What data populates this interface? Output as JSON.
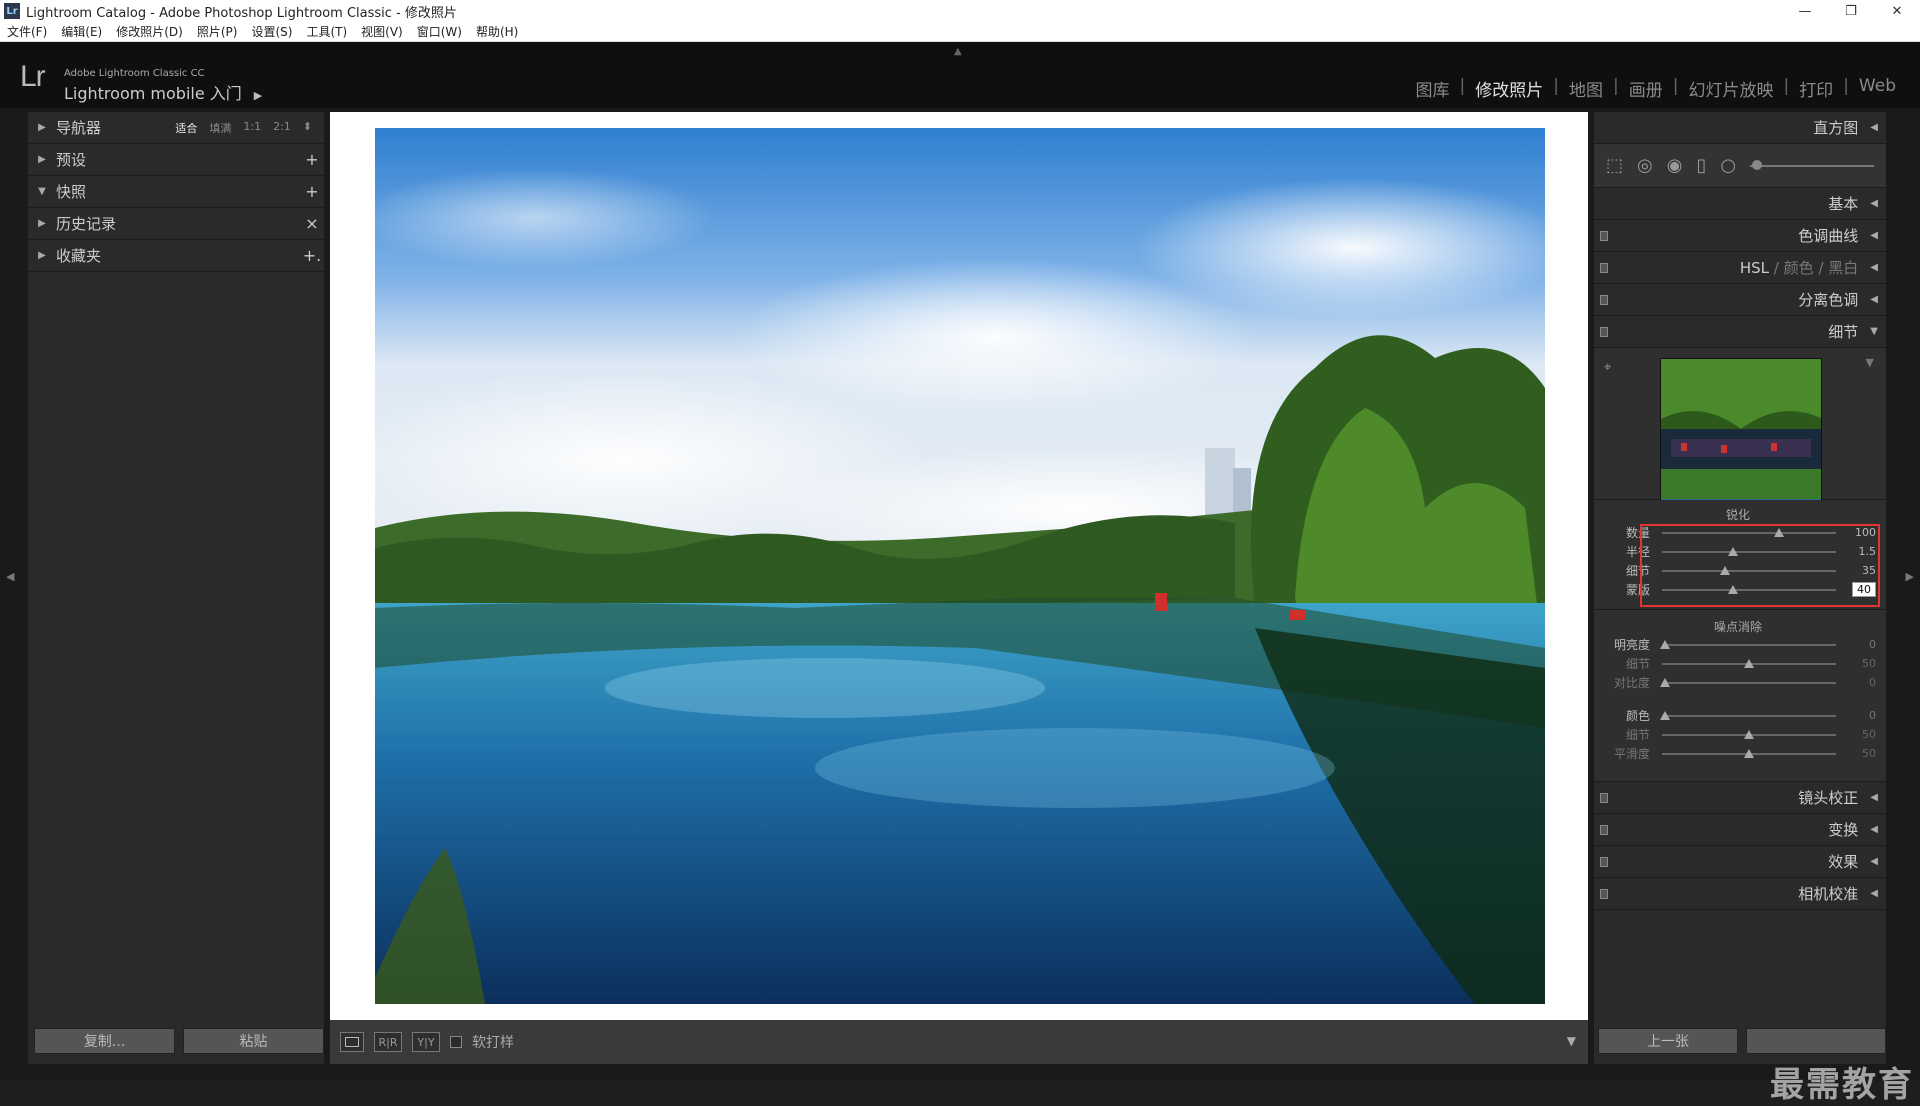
{
  "titlebar": {
    "title": "Lightroom Catalog - Adobe Photoshop Lightroom Classic - 修改照片",
    "app_icon": "Lr",
    "min": "—",
    "max": "❐",
    "close": "✕"
  },
  "menu": [
    "文件(F)",
    "编辑(E)",
    "修改照片(D)",
    "照片(P)",
    "设置(S)",
    "工具(T)",
    "视图(V)",
    "窗口(W)",
    "帮助(H)"
  ],
  "identity": {
    "logo": "Lr",
    "product": "Adobe Lightroom Classic CC",
    "mobile": "Lightroom mobile 入门",
    "play": "▶"
  },
  "modules": {
    "library": "图库",
    "develop": "修改照片",
    "map": "地图",
    "book": "画册",
    "slideshow": "幻灯片放映",
    "print": "打印",
    "web": "Web"
  },
  "left": {
    "navigator": {
      "label": "导航器",
      "fit": "适合",
      "fill": "填满",
      "one": "1:1",
      "two": "2:1"
    },
    "presets": {
      "label": "预设",
      "action": "+"
    },
    "snapshots": {
      "label": "快照",
      "action": "+"
    },
    "history": {
      "label": "历史记录",
      "action": "×"
    },
    "collections": {
      "label": "收藏夹",
      "action": "+."
    },
    "copy": "复制...",
    "paste": "粘贴"
  },
  "toolbar": {
    "view_loupe": "",
    "view_rr": "R|R",
    "view_yy": "Y|Y",
    "softproof": "软打样"
  },
  "right": {
    "histogram": "直方图",
    "basic": "基本",
    "tonecurve": "色调曲线",
    "hsl": "HSL",
    "hsl_sep": "/",
    "color": "颜色",
    "bw": "黑白",
    "split": "分离色调",
    "detail": "细节",
    "sharpening": {
      "title": "锐化",
      "amount": {
        "label": "数量",
        "value": "100",
        "pos": 0.67
      },
      "radius": {
        "label": "半径",
        "value": "1.5",
        "pos": 0.41
      },
      "detail": {
        "label": "细节",
        "value": "35",
        "pos": 0.36
      },
      "masking": {
        "label": "蒙版",
        "value": "40",
        "pos": 0.41
      }
    },
    "noise": {
      "title": "噪点消除",
      "luminance": {
        "label": "明亮度",
        "value": "0",
        "pos": 0.02
      },
      "lum_detail": {
        "label": "细节",
        "value": "50",
        "pos": 0.5
      },
      "lum_contrast": {
        "label": "对比度",
        "value": "0",
        "pos": 0.02
      },
      "color": {
        "label": "颜色",
        "value": "0",
        "pos": 0.02
      },
      "col_detail": {
        "label": "细节",
        "value": "50",
        "pos": 0.5
      },
      "smooth": {
        "label": "平滑度",
        "value": "50",
        "pos": 0.5
      }
    },
    "lens": "镜头校正",
    "transform": "变换",
    "effects": "效果",
    "calibration": "相机校准",
    "prev": "上一张"
  },
  "watermark": "最需教育",
  "colors": {
    "accent_red": "#e33333"
  }
}
